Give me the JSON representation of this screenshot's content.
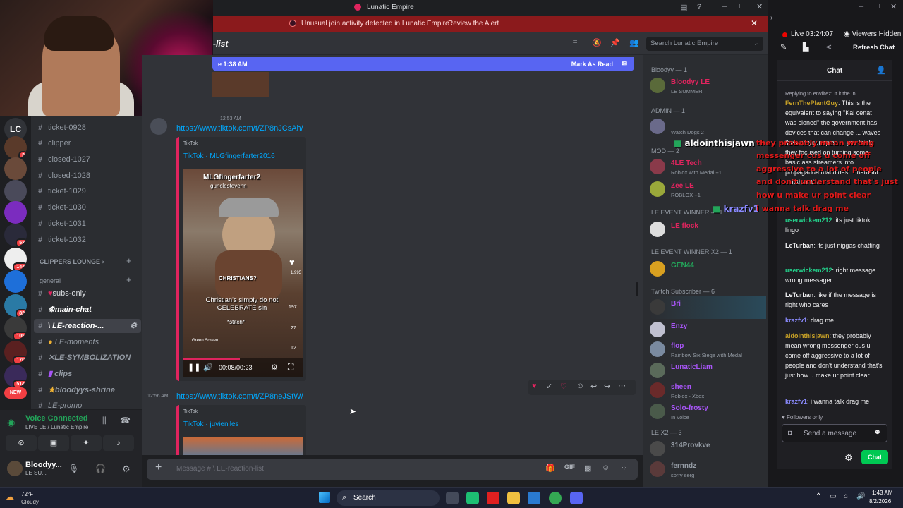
{
  "window": {
    "title": "Lunatic Empire"
  },
  "alert": {
    "text": "Unusual join activity detected in Lunatic Empire",
    "action": "Review the Alert"
  },
  "channel_header": {
    "name": "-list",
    "search_placeholder": "Search Lunatic Empire"
  },
  "new_messages": {
    "text": "e 1:38 AM",
    "action": "Mark As Read"
  },
  "channels": {
    "items": [
      "ticket-0928",
      "clipper",
      "closed-1027",
      "closed-1028",
      "ticket-1029",
      "ticket-1030",
      "ticket-1031",
      "ticket-1032"
    ],
    "clippers_category": "CLIPPERS LOUNGE",
    "general_category": "general",
    "general_items": [
      "subs-only",
      "main-chat",
      "\\ LE-reaction-...",
      "LE-moments",
      "LE-SYMBOLIZATION",
      "clips",
      "bloodyys-shrine",
      "LE-promo"
    ]
  },
  "servers": {
    "badges": [
      "3",
      "53",
      "144",
      "82",
      "105",
      "170",
      "514"
    ],
    "new_badge": "NEW"
  },
  "voice": {
    "status": "Voice Connected",
    "location": "LIVE LE / Lunatic Empire"
  },
  "user": {
    "name": "Bloodyy...",
    "status": "LE SU..."
  },
  "messages": [
    {
      "time": "12:53 AM",
      "link": "https://www.tiktok.com/t/ZP8nJCsAh/",
      "provider": "TikTok",
      "embed_title": "TikTok · MLGfingerfarter2016",
      "video": {
        "overlay_user": "MLGfingerfarter2",
        "overlay_handle": "gunclestevenn",
        "overlay_label": "CHRISTIANS?",
        "caption": "Christian's simply do not CELEBRATE sin",
        "stitch": "*stitch*",
        "green_screen": "Green Screen",
        "time": "00:08/00:23",
        "likes": "1,995",
        "comments": "197",
        "shares": "27",
        "saves": "12"
      }
    },
    {
      "time": "12:56 AM",
      "link": "https://www.tiktok.com/t/ZP8neJStW/",
      "provider": "TikTok",
      "embed_title": "TikTok · juvieniles"
    }
  ],
  "composer": {
    "placeholder": "Message # \\ LE-reaction-list"
  },
  "members": {
    "groups": [
      "Bloodyy — 1",
      "ADMIN — 1",
      "MOD — 2",
      "LE EVENT WINNER — 1",
      "LE EVENT WINNER X2 — 1",
      "Twitch Subscriber — 6",
      "LE X2 — 3"
    ],
    "list": [
      {
        "name": "Bloodyy LE",
        "status": "LE SUMMER",
        "color": "#e0245e"
      },
      {
        "name": "",
        "status": "Watch Dogs 2",
        "color": "#dbdee1"
      },
      {
        "name": "4LE Tech",
        "status": "Roblox with Medal +1",
        "color": "#e0245e"
      },
      {
        "name": "Zee LE",
        "status": "ROBLOX +1",
        "color": "#e0245e"
      },
      {
        "name": "LE flock",
        "status": "",
        "color": "#e0245e"
      },
      {
        "name": "GEN44",
        "status": "",
        "color": "#23a55a"
      },
      {
        "name": "Bri",
        "status": "",
        "color": "#a855f7"
      },
      {
        "name": "Enzy",
        "status": "",
        "color": "#a855f7"
      },
      {
        "name": "flop",
        "status": "Rainbow Six Siege with Medal",
        "color": "#a855f7"
      },
      {
        "name": "LunaticLiam",
        "status": "",
        "color": "#a855f7"
      },
      {
        "name": "sheen",
        "status": "Roblox - Xbox",
        "color": "#a855f7"
      },
      {
        "name": "Solo-frosty",
        "status": "In voice",
        "color": "#a855f7"
      },
      {
        "name": "314Provkve",
        "status": "",
        "color": "#949ba4"
      },
      {
        "name": "fernndz",
        "status": "sorry serg",
        "color": "#949ba4"
      }
    ]
  },
  "stream": {
    "live": "Live 03:24:07",
    "viewers": "Viewers Hidden",
    "refresh": "Refresh Chat"
  },
  "twitch_chat": {
    "title": "Chat",
    "reply": "Replying to envlitez: It it the in...",
    "messages": [
      {
        "user": "FernThePlantGuy",
        "color": "#c9a227",
        "text": "This is the equivalent to saying \"Kai cenat was cloned\" the government has devices that can change ... waves through your spine ... you think they focused on turning some basic ass streamers into propaganda machines ... harmful shit then that"
      },
      {
        "user": "userwickem212",
        "color": "#23d18b",
        "text": "its just tiktok lingo"
      },
      {
        "user": "LeTurban",
        "color": "#efeff1",
        "text": "its just niggas chatting"
      },
      {
        "user": "userwickem212",
        "color": "#23d18b",
        "text": "right message wrong messager"
      },
      {
        "user": "LeTurban",
        "color": "#efeff1",
        "text": "like if the message is right who cares"
      },
      {
        "user": "krazfv1",
        "color": "#8b8bff",
        "text": "drag me"
      },
      {
        "user": "aldointhisjawn",
        "color": "#c9a227",
        "text": "they probably mean wrong messenger cus u come off aggressive to a lot of people and don't understand that's just how u make ur point clear"
      },
      {
        "user": "krazfv1",
        "color": "#8b8bff",
        "text": "i wanna talk drag me"
      }
    ],
    "followers_only": "Followers only",
    "input_placeholder": "Send a message",
    "chat_button": "Chat"
  },
  "overlay": {
    "user1": "aldointhisjawn",
    "user2": "krazfv1",
    "lines": [
      "they probably mean wrong",
      "messenger cus u come off",
      "aggressive to a lot of people",
      "and don't understand that's just",
      "how u make ur point clear",
      "i wanna talk drag me"
    ]
  },
  "taskbar": {
    "weather_temp": "72°F",
    "weather_desc": "Cloudy",
    "search": "Search",
    "time": "1:43 AM",
    "date": "8/2/2026"
  }
}
